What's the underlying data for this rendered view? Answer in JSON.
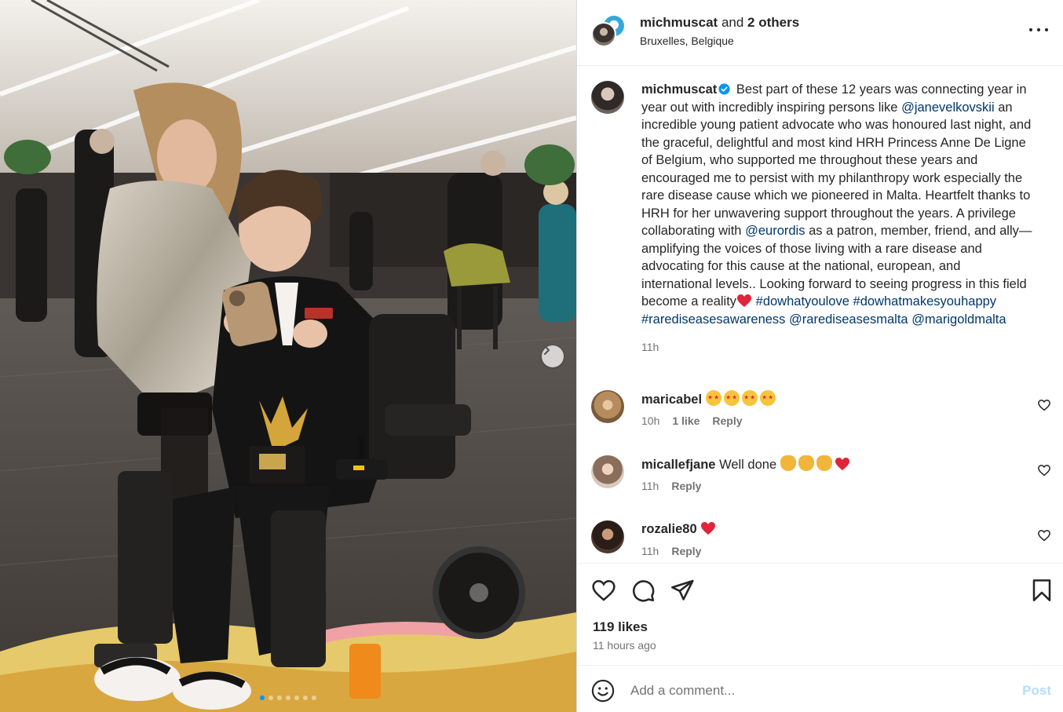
{
  "post": {
    "header": {
      "username": "michmuscat",
      "and_text": "and",
      "others_text": "2 others",
      "location": "Bruxelles, Belgique"
    },
    "caption": {
      "username": "michmuscat",
      "verified": true,
      "text_1": "Best part of these 12 years was connecting year in year out with incredibly inspiring persons like",
      "mention_1": "@janevelkovskii",
      "text_2": "an incredible young patient advocate who was honoured last night, and the graceful, delightful and most kind HRH Princess Anne De Ligne of Belgium, who supported me throughout these years and encouraged me to persist with my philanthropy work especially the rare disease cause which we pioneered in Malta. Heartfelt thanks to HRH for her unwavering support throughout the years. A privilege collaborating with",
      "mention_2": "@eurordis",
      "text_3": "as a patron, member, friend, and ally—amplifying the voices of those living with a rare disease and advocating for this cause at the national, european, and international levels.. Looking forward to seeing progress in this field become a reality",
      "hashtag_1": "#dowhatyoulove",
      "hashtag_2": "#dowhatmakesyouhappy",
      "hashtag_3": "#rarediseasesawareness",
      "mention_3": "@rarediseasesmalta",
      "mention_4": "@marigoldmalta",
      "time": "11h"
    },
    "comments": [
      {
        "username": "maricabel",
        "text": "",
        "emoji_icons": [
          "star-struck-emoji",
          "star-struck-emoji",
          "star-struck-emoji",
          "star-struck-emoji"
        ],
        "time": "10h",
        "likes": "1 like",
        "reply": "Reply"
      },
      {
        "username": "micallefjane",
        "text": "Well done",
        "emoji_icons": [
          "clapping-emoji",
          "clapping-emoji",
          "clapping-emoji",
          "red-heart-emoji"
        ],
        "time": "11h",
        "likes": "",
        "reply": "Reply"
      },
      {
        "username": "rozalie80",
        "text": "",
        "emoji_icons": [
          "red-heart-emoji"
        ],
        "time": "11h",
        "likes": "",
        "reply": "Reply"
      }
    ],
    "likes_count": "119 likes",
    "posted_ago": "11 hours ago",
    "comment_box": {
      "placeholder": "Add a comment...",
      "post_label": "Post"
    },
    "carousel": {
      "total_images": 7,
      "current_index": 0
    },
    "colors": {
      "link": "#00376b",
      "verified": "#0095f6",
      "post_disabled": "#b2dffc",
      "heart": "#e0243a"
    },
    "icons": [
      "more-options-icon",
      "verified-badge-icon",
      "heart-icon",
      "comment-icon",
      "share-icon",
      "bookmark-icon",
      "emoji-icon",
      "next-image-icon"
    ]
  }
}
